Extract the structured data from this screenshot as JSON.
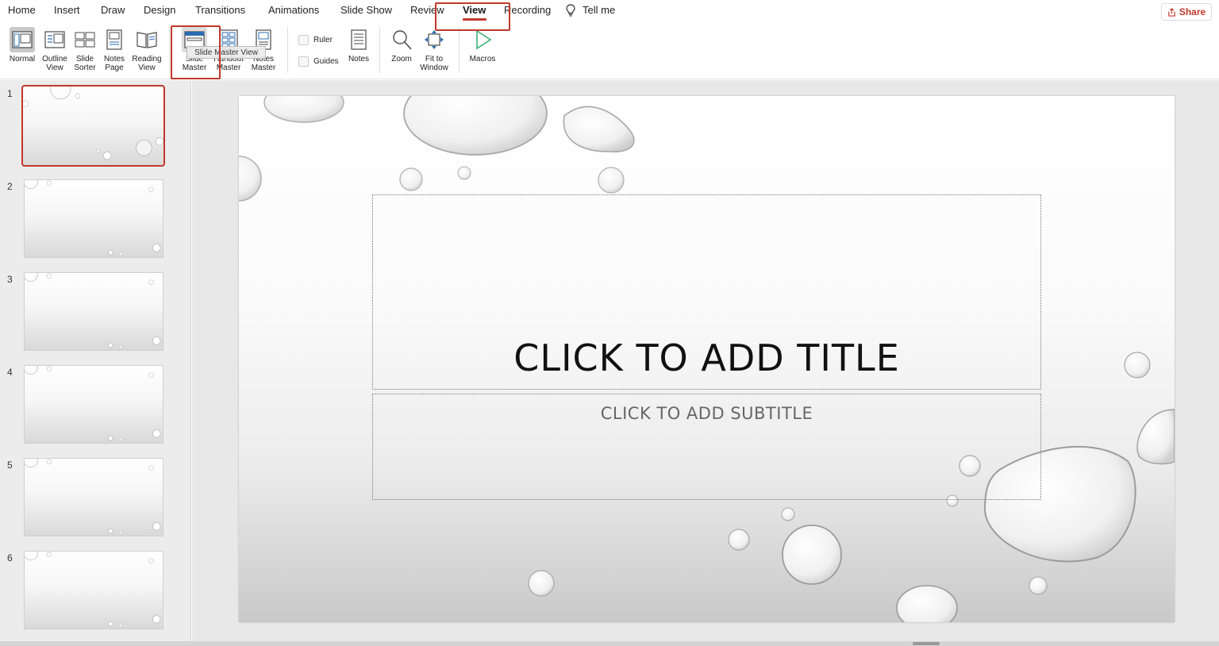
{
  "tabs": [
    {
      "label": "Home"
    },
    {
      "label": "Insert"
    },
    {
      "label": "Draw"
    },
    {
      "label": "Design"
    },
    {
      "label": "Transitions"
    },
    {
      "label": "Animations"
    },
    {
      "label": "Slide Show"
    },
    {
      "label": "Review"
    },
    {
      "label": "View"
    },
    {
      "label": "Recording"
    }
  ],
  "tell_me": "Tell me",
  "share": "Share",
  "ribbon": {
    "normal": [
      "Normal"
    ],
    "outline": [
      "Outline",
      "View"
    ],
    "sorter": [
      "Slide",
      "Sorter"
    ],
    "notes_page": [
      "Notes",
      "Page"
    ],
    "reading": [
      "Reading",
      "View"
    ],
    "slide_master": [
      "Slide",
      "Master"
    ],
    "handout_master": [
      "Handout",
      "Master"
    ],
    "notes_master": [
      "Notes",
      "Master"
    ],
    "ruler": "Ruler",
    "guides": "Guides",
    "notes": "Notes",
    "zoom": "Zoom",
    "fit_window": [
      "Fit to",
      "Window"
    ],
    "macros": "Macros"
  },
  "tooltip": "Slide Master View",
  "thumbnails": [
    "1",
    "2",
    "3",
    "4",
    "5",
    "6"
  ],
  "slide": {
    "title": "CLICK TO ADD TITLE",
    "subtitle": "CLICK TO ADD SUBTITLE"
  },
  "colors": {
    "accent": "#c0392b",
    "macros_play": "#3bb273"
  }
}
